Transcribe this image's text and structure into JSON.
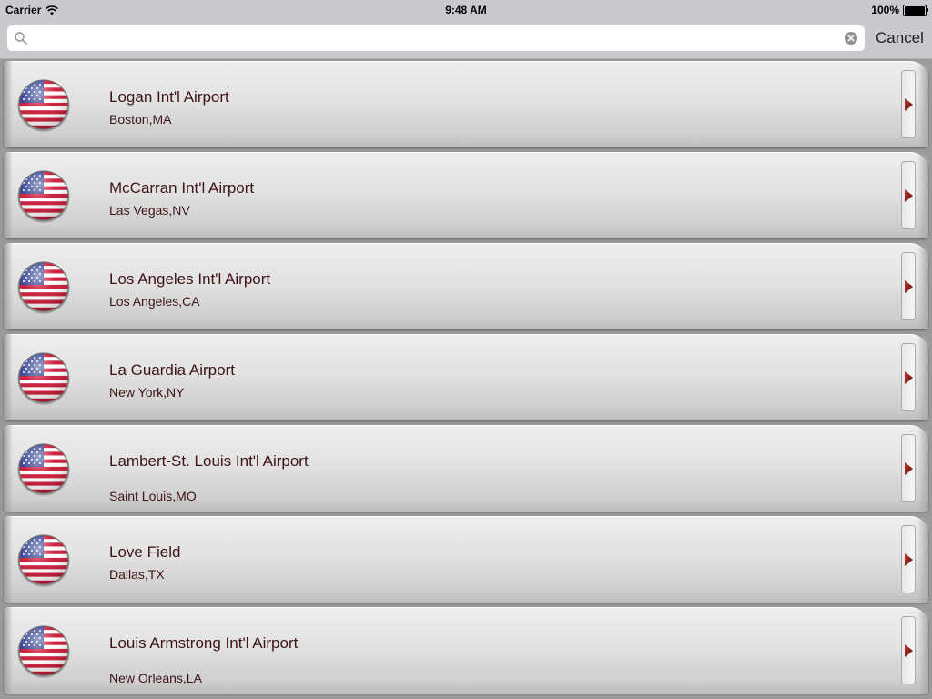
{
  "status_bar": {
    "carrier": "Carrier",
    "time": "9:48 AM",
    "battery": "100%"
  },
  "search": {
    "value": "",
    "placeholder": "",
    "cancel_label": "Cancel"
  },
  "airports": [
    {
      "name": "Logan Int'l Airport",
      "city": "Boston,MA"
    },
    {
      "name": "McCarran Int'l Airport",
      "city": "Las Vegas,NV"
    },
    {
      "name": "Los Angeles Int'l Airport",
      "city": "Los Angeles,CA"
    },
    {
      "name": "La Guardia Airport",
      "city": "New York,NY"
    },
    {
      "name": "Lambert-St. Louis Int'l Airport",
      "city": "Saint Louis,MO"
    },
    {
      "name": "Love Field",
      "city": "Dallas,TX"
    },
    {
      "name": "Louis Armstrong Int'l Airport",
      "city": "New Orleans,LA"
    }
  ],
  "icons": {
    "row_icon": "us-flag-icon",
    "disclosure": "disclosure-arrow-icon",
    "search": "search-icon",
    "clear": "clear-icon"
  },
  "colors": {
    "text": "#3e1416",
    "arrow": "#8b1a1a",
    "bar_background": "#c9c9ce"
  }
}
